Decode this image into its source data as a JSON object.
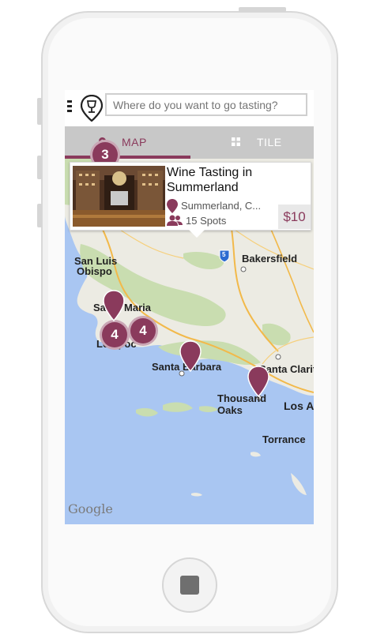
{
  "colors": {
    "accent": "#8a3a5c",
    "tab_bar": "#c8c8c8",
    "map_water": "#a9c6f2",
    "map_land": "#ecebe3",
    "map_green": "#c9ddb0"
  },
  "search": {
    "placeholder": "Where do you want to go tasting?"
  },
  "icons": {
    "menu": "hamburger-icon",
    "brand": "wine-glass-pin-icon",
    "map_tab": "map-pin-icon",
    "tile_tab": "grid-icon",
    "location": "map-pin-icon",
    "spots": "users-icon"
  },
  "tabs": {
    "map": "MAP",
    "tile": "TILE"
  },
  "card": {
    "title": "Wine Tasting in Summerland",
    "location": "Summerland, C...",
    "spots": "15 Spots",
    "price": "$10"
  },
  "map": {
    "cities": {
      "bakersfield": "Bakersfield",
      "san_luis": "San Luis",
      "obispo": "Obispo",
      "santa_maria": "Santa Maria",
      "lompoc": "Lompoc",
      "santa_barbara": "Santa Barbara",
      "santa_clarita": "Santa Clarita",
      "thousand_oaks": "Thousand Oaks",
      "los_angeles": "Los An",
      "torrance": "Torrance"
    },
    "highway": "5",
    "clusters": {
      "top": "3",
      "mid1": "4",
      "mid2": "4"
    },
    "attribution": "Google"
  }
}
